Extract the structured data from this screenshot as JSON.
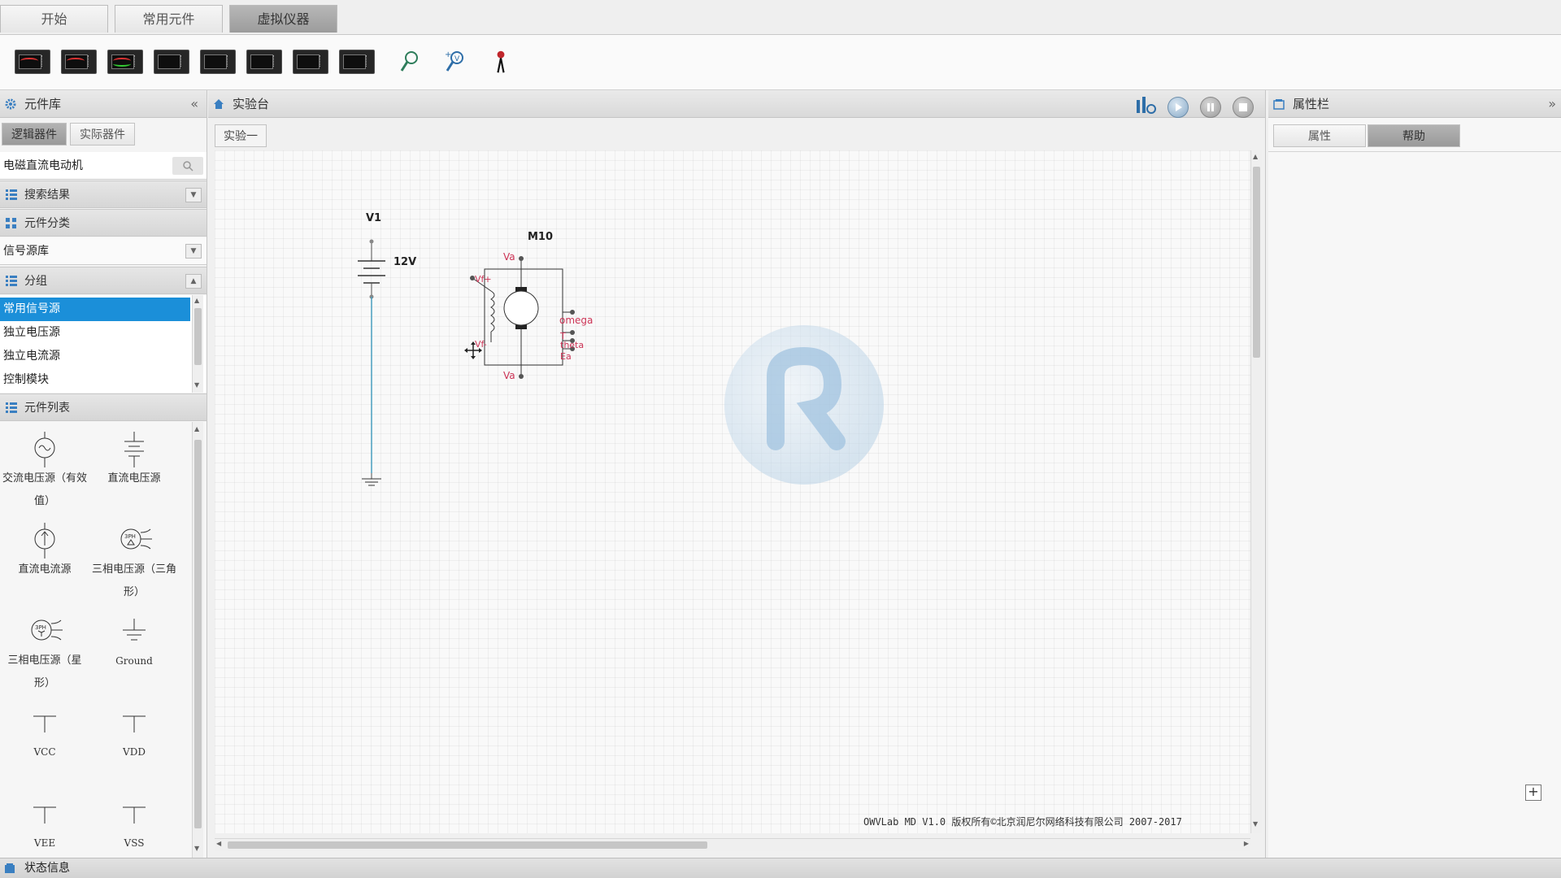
{
  "top_tabs": [
    "开始",
    "常用元件",
    "虚拟仪器"
  ],
  "left_panel": {
    "title": "元件库",
    "subtabs": [
      "逻辑器件",
      "实际器件"
    ],
    "search_value": "电磁直流电动机",
    "search_results_label": "搜索结果",
    "category_label": "元件分类",
    "category_value": "信号源库",
    "group_label": "分组",
    "groups": [
      "常用信号源",
      "独立电压源",
      "独立电流源",
      "控制模块"
    ],
    "component_list_label": "元件列表",
    "components": [
      {
        "label": "交流电压源（有效值）",
        "icon": "ac-voltage-source-icon"
      },
      {
        "label": "直流电压源",
        "icon": "dc-voltage-source-icon"
      },
      {
        "label": "直流电流源",
        "icon": "dc-current-source-icon"
      },
      {
        "label": "三相电压源（三角形）",
        "icon": "three-phase-delta-icon"
      },
      {
        "label": "三相电压源（星形）",
        "icon": "three-phase-star-icon"
      },
      {
        "label": "Ground",
        "icon": "ground-icon"
      },
      {
        "label": "VCC",
        "icon": "vcc-icon"
      },
      {
        "label": "VDD",
        "icon": "vdd-icon"
      },
      {
        "label": "VEE",
        "icon": "vee-icon"
      },
      {
        "label": "VSS",
        "icon": "vss-icon"
      }
    ]
  },
  "center_panel": {
    "title": "实验台",
    "experiment_tab": "实验一",
    "circuit": {
      "battery_name": "V1",
      "battery_value": "12V",
      "motor_name": "M10",
      "motor_pins": {
        "top": "Va",
        "bottom": "Va",
        "field": "Vf+",
        "field_minus": "Vf-",
        "omega": "omega",
        "t": "T",
        "theta": "theta",
        "ea": "Ea"
      }
    },
    "footer": "OWVLab MD V1.0 版权所有©北京润尼尔网络科技有限公司 2007-2017"
  },
  "right_panel": {
    "title": "属性栏",
    "subtabs": [
      "属性",
      "帮助"
    ]
  },
  "status_bar": {
    "label": "状态信息"
  },
  "colors": {
    "accent": "#1b8fd9",
    "pin_label": "#cc3355",
    "wire": "#4aa0c0"
  }
}
